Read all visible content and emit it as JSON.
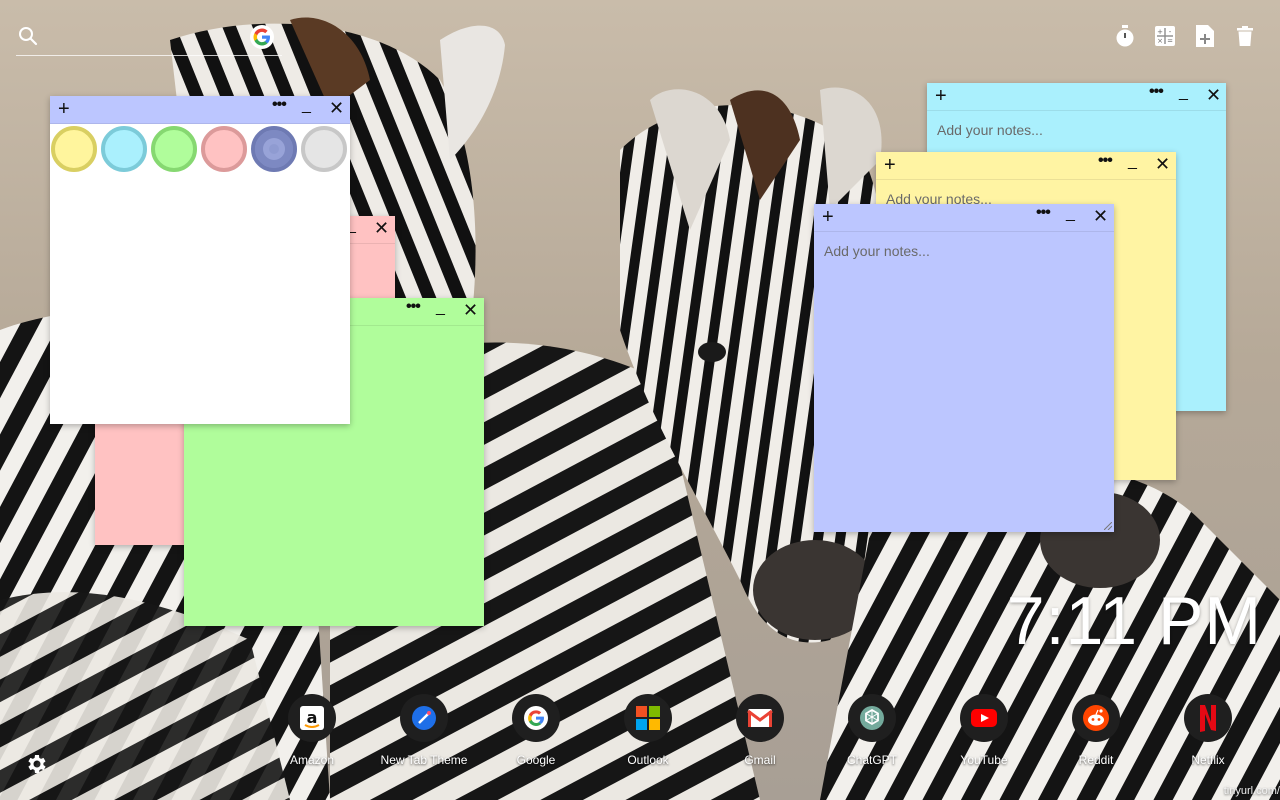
{
  "search": {
    "search_icon": "search-icon",
    "provider_icon": "google-g-icon"
  },
  "toolbar": {
    "tools": [
      "timer-icon",
      "calculator-icon",
      "add-note-icon",
      "trash-icon"
    ]
  },
  "notes": {
    "placeholder": "Add your notes...",
    "plus": "+",
    "menu": "•••",
    "minimize": "_",
    "close": "✕",
    "colors": {
      "white": "#ffffff",
      "pink": "#ffc2c2",
      "green": "#b0fd9b",
      "cyan": "#aaf0fd",
      "yellow": "#fff4a3",
      "blue": "#bcc6ff"
    },
    "swatches": [
      {
        "name": "yellow",
        "fill": "#fff59d",
        "ring": "#d9cf62"
      },
      {
        "name": "cyan",
        "fill": "#aaf0fd",
        "ring": "#7ccbd9"
      },
      {
        "name": "green",
        "fill": "#b0fd9b",
        "ring": "#86d871"
      },
      {
        "name": "pink",
        "fill": "#ffc2c2",
        "ring": "#dc9a9a"
      },
      {
        "name": "blue",
        "fill": "#8f9bd1",
        "ring": "#6e7ab3"
      },
      {
        "name": "gray",
        "fill": "#e5e5e5",
        "ring": "#c7c7c7"
      }
    ]
  },
  "clock": {
    "time": "7:11 PM"
  },
  "shortcuts": [
    {
      "label": "Amazon",
      "icon": "amazon-icon"
    },
    {
      "label": "New Tab Theme",
      "icon": "new-tab-theme-icon"
    },
    {
      "label": "Google",
      "icon": "google-icon"
    },
    {
      "label": "Outlook",
      "icon": "outlook-icon"
    },
    {
      "label": "Gmail",
      "icon": "gmail-icon"
    },
    {
      "label": "ChatGPT",
      "icon": "chatgpt-icon"
    },
    {
      "label": "YouTube",
      "icon": "youtube-icon"
    },
    {
      "label": "Reddit",
      "icon": "reddit-icon"
    },
    {
      "label": "Netflix",
      "icon": "netflix-icon"
    }
  ],
  "settings": {
    "icon": "gear-icon"
  },
  "footer": {
    "link": "tinyurl.com/"
  }
}
